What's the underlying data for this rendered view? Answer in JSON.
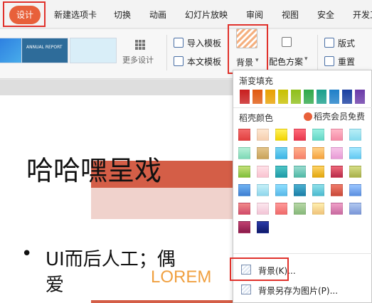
{
  "menu": {
    "design": "设计",
    "items": [
      "新建选项卡",
      "切换",
      "动画",
      "幻灯片放映",
      "审阅",
      "视图",
      "安全",
      "开发工"
    ]
  },
  "ribbon": {
    "templates": [
      {
        "text": ""
      },
      {
        "text": "ANNUAL REPORT"
      },
      {
        "text": ""
      }
    ],
    "more_designs": "更多设计",
    "import_template": "导入模板",
    "this_template": "本文模板",
    "background": "背景",
    "color_scheme": "配色方案",
    "layout": "版式",
    "rearrange": "重置"
  },
  "slide": {
    "title": "哈哈嘿呈戏",
    "bullet_line1": "UI而后人工；偶",
    "bullet_line2": "爱",
    "lorem": "LOREM"
  },
  "dropdown": {
    "gradient_fill": "渐变填充",
    "shell_colors": "稻壳颜色",
    "vip_free": "稻壳会员免费",
    "background_item": "背景(K)...",
    "save_background": "背景另存为图片(P)...",
    "solid_colors": [
      "#c81e1e",
      "#e05a10",
      "#e8a000",
      "#c8c000",
      "#8fbf1a",
      "#2fa84a",
      "#1a9f8c",
      "#1f7fc8",
      "#1a3fa0",
      "#6a3aa8"
    ],
    "gradient_rows": [
      [
        "linear-gradient(#f26a6a,#e24040)",
        "linear-gradient(#fde7d2,#f6cfae)",
        "linear-gradient(#fff35c,#f2d200)",
        "linear-gradient(#ff6b7a,#e8364c)",
        "linear-gradient(#9af0e2,#63d7c5)",
        "linear-gradient(#ffb7c8,#f58aa6)",
        "linear-gradient(#b8eef6,#86dbee)"
      ],
      [
        "linear-gradient(#b6f0d8,#7ed9b6)",
        "linear-gradient(#e3c48a,#c9a35a)",
        "linear-gradient(#7ad6f2,#3bb4e6)",
        "linear-gradient(#ffb08a,#f7806a)",
        "linear-gradient(#ffd28a,#f6a23c)",
        "linear-gradient(#f7c5e8,#e89ad6)",
        "linear-gradient(#a6e9ff,#62c8f2)"
      ],
      [
        "linear-gradient(#c6e07a,#7fbf3a)",
        "linear-gradient(#ffe2e8,#f9c2d0)",
        "linear-gradient(#4fc6c6,#1e9aa8)",
        "linear-gradient(#9bdccf,#4fb8a6)",
        "linear-gradient(#ffd36a,#e2a70c)",
        "linear-gradient(#f06a7a,#b82b4a)",
        "linear-gradient(#d6dd86,#a8b04a)"
      ],
      [
        "linear-gradient(#6fb2f2,#3f7fd2)",
        "linear-gradient(#c6f0f8,#8ed6ec)",
        "linear-gradient(#8edfff,#58b8e8)",
        "linear-gradient(#49b0d0,#1d7fa8)",
        "linear-gradient(#8fe0ea,#4cbad0)",
        "linear-gradient(#f07a6a,#c84a3a)",
        "linear-gradient(#9ac6ff,#5c8fe0)"
      ],
      [
        "linear-gradient(#f28a8a,#d04a6a)",
        "linear-gradient(#fce7ee,#f2c4d6)",
        "linear-gradient(#ff9a9a,#f06a6a)",
        "linear-gradient(#b8d8a6,#86b87a)",
        "linear-gradient(#fff0b0,#f0c27a)",
        "linear-gradient(#f0a0c8,#c86aa0)",
        "linear-gradient(#b0c8f0,#7a96d8)"
      ],
      [
        "linear-gradient(#c04070,#8a1a4a)",
        "linear-gradient(#2a3aa8,#101a6a)"
      ]
    ]
  }
}
